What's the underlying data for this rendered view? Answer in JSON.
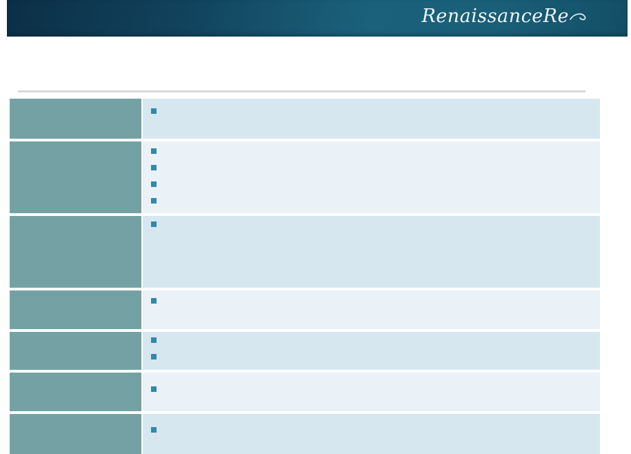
{
  "header": {
    "logo_text": "RenaissanceRe",
    "bar_color_left": "#0c2f47",
    "bar_color_mid": "#1b617b",
    "bar_color_right": "#124f66",
    "logo_color": "#eef6fa"
  },
  "divider": {
    "color": "#d9d9d9"
  },
  "table": {
    "left_column_color": "#74a2a4",
    "bullet_color": "#3289a9",
    "row_tones": {
      "a": "#d7e7ef",
      "b": "#ebf2f7"
    },
    "rows": [
      {
        "label": "",
        "tone": "a",
        "bullets": [
          ""
        ]
      },
      {
        "label": "",
        "tone": "b",
        "bullets": [
          "",
          "",
          "",
          ""
        ]
      },
      {
        "label": "",
        "tone": "a",
        "bullets": [
          ""
        ]
      },
      {
        "label": "",
        "tone": "b",
        "bullets": [
          ""
        ]
      },
      {
        "label": "",
        "tone": "a",
        "bullets": [
          "",
          ""
        ]
      },
      {
        "label": "",
        "tone": "b",
        "bullets": [
          ""
        ]
      },
      {
        "label": "",
        "tone": "a",
        "bullets": [
          ""
        ]
      }
    ]
  }
}
